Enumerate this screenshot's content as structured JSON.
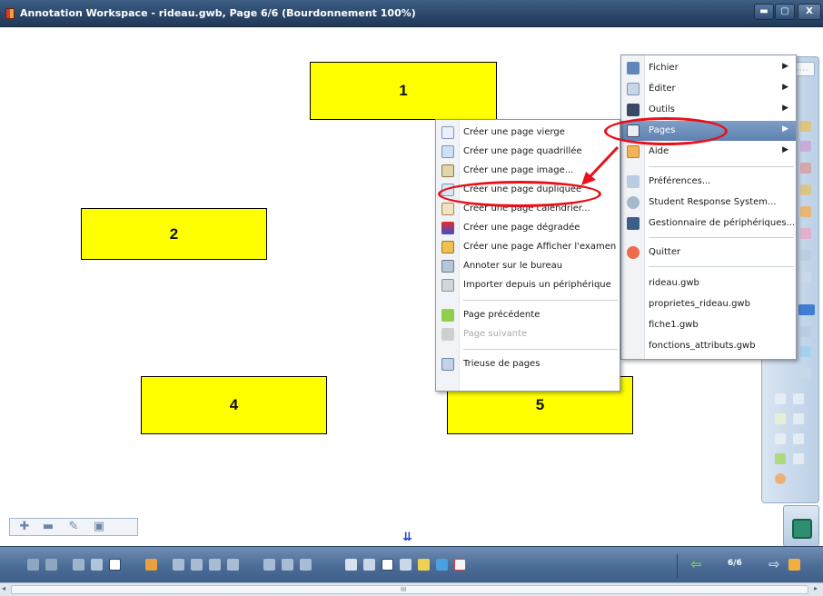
{
  "window": {
    "title": "Annotation Workspace - rideau.gwb, Page 6/6  (Bourdonnement 100%)",
    "min_icon": "minimize-icon",
    "max_icon": "maximize-icon",
    "close_icon": "close-icon",
    "min_glyph": "▬",
    "max_glyph": "▢",
    "close_glyph": "X"
  },
  "canvas": {
    "boxes": [
      "1",
      "2",
      "4",
      "5"
    ]
  },
  "main_menu": {
    "items": [
      {
        "label": "Fichier",
        "icon": "file-icon",
        "submenu": true
      },
      {
        "label": "Éditer",
        "icon": "edit-icon",
        "submenu": true
      },
      {
        "label": "Outils",
        "icon": "tools-icon",
        "submenu": true
      },
      {
        "label": "Pages",
        "icon": "pages-icon",
        "submenu": true,
        "highlighted": true
      },
      {
        "label": "Aide",
        "icon": "help-icon",
        "submenu": true
      },
      {
        "label": "Préférences...",
        "icon": "preferences-icon"
      },
      {
        "label": "Student Response System...",
        "icon": "response-system-icon"
      },
      {
        "label": "Gestionnaire de périphériques...",
        "icon": "device-manager-icon"
      },
      {
        "label": "Quitter",
        "icon": "quit-icon"
      },
      {
        "label": "rideau.gwb"
      },
      {
        "label": "proprietes_rideau.gwb"
      },
      {
        "label": "fiche1.gwb"
      },
      {
        "label": "fonctions_attributs.gwb"
      }
    ]
  },
  "pages_submenu": {
    "items": [
      {
        "label": "Créer une page vierge",
        "icon": "blank-page-icon"
      },
      {
        "label": "Créer une page quadrillée",
        "icon": "grid-page-icon"
      },
      {
        "label": "Créer une page image...",
        "icon": "image-page-icon"
      },
      {
        "label": "Créer une page dupliquée",
        "icon": "duplicate-page-icon",
        "circled": true
      },
      {
        "label": "Créer une page calendrier...",
        "icon": "calendar-page-icon"
      },
      {
        "label": "Créer une page dégradée",
        "icon": "gradient-page-icon"
      },
      {
        "label": "Créer une page Afficher l'examen",
        "icon": "exam-page-icon"
      },
      {
        "label": "Annoter sur le bureau",
        "icon": "desktop-annotate-icon"
      },
      {
        "label": "Importer depuis un périphérique",
        "icon": "import-device-icon"
      },
      {
        "label": "Page précédente",
        "icon": "previous-page-icon"
      },
      {
        "label": "Page suivante",
        "icon": "next-page-icon",
        "disabled": true
      },
      {
        "label": "Trieuse de pages",
        "icon": "page-sorter-icon"
      }
    ]
  },
  "bottom_toolbar": {
    "page_indicator": "6/6",
    "prev_glyph": "⇦",
    "next_glyph": "⇨"
  },
  "page_nav_glyph": "⇊",
  "colors": {
    "box_fill": "#ffff00",
    "highlight": "#6b8dbb",
    "annotation_red": "#e8101a"
  }
}
